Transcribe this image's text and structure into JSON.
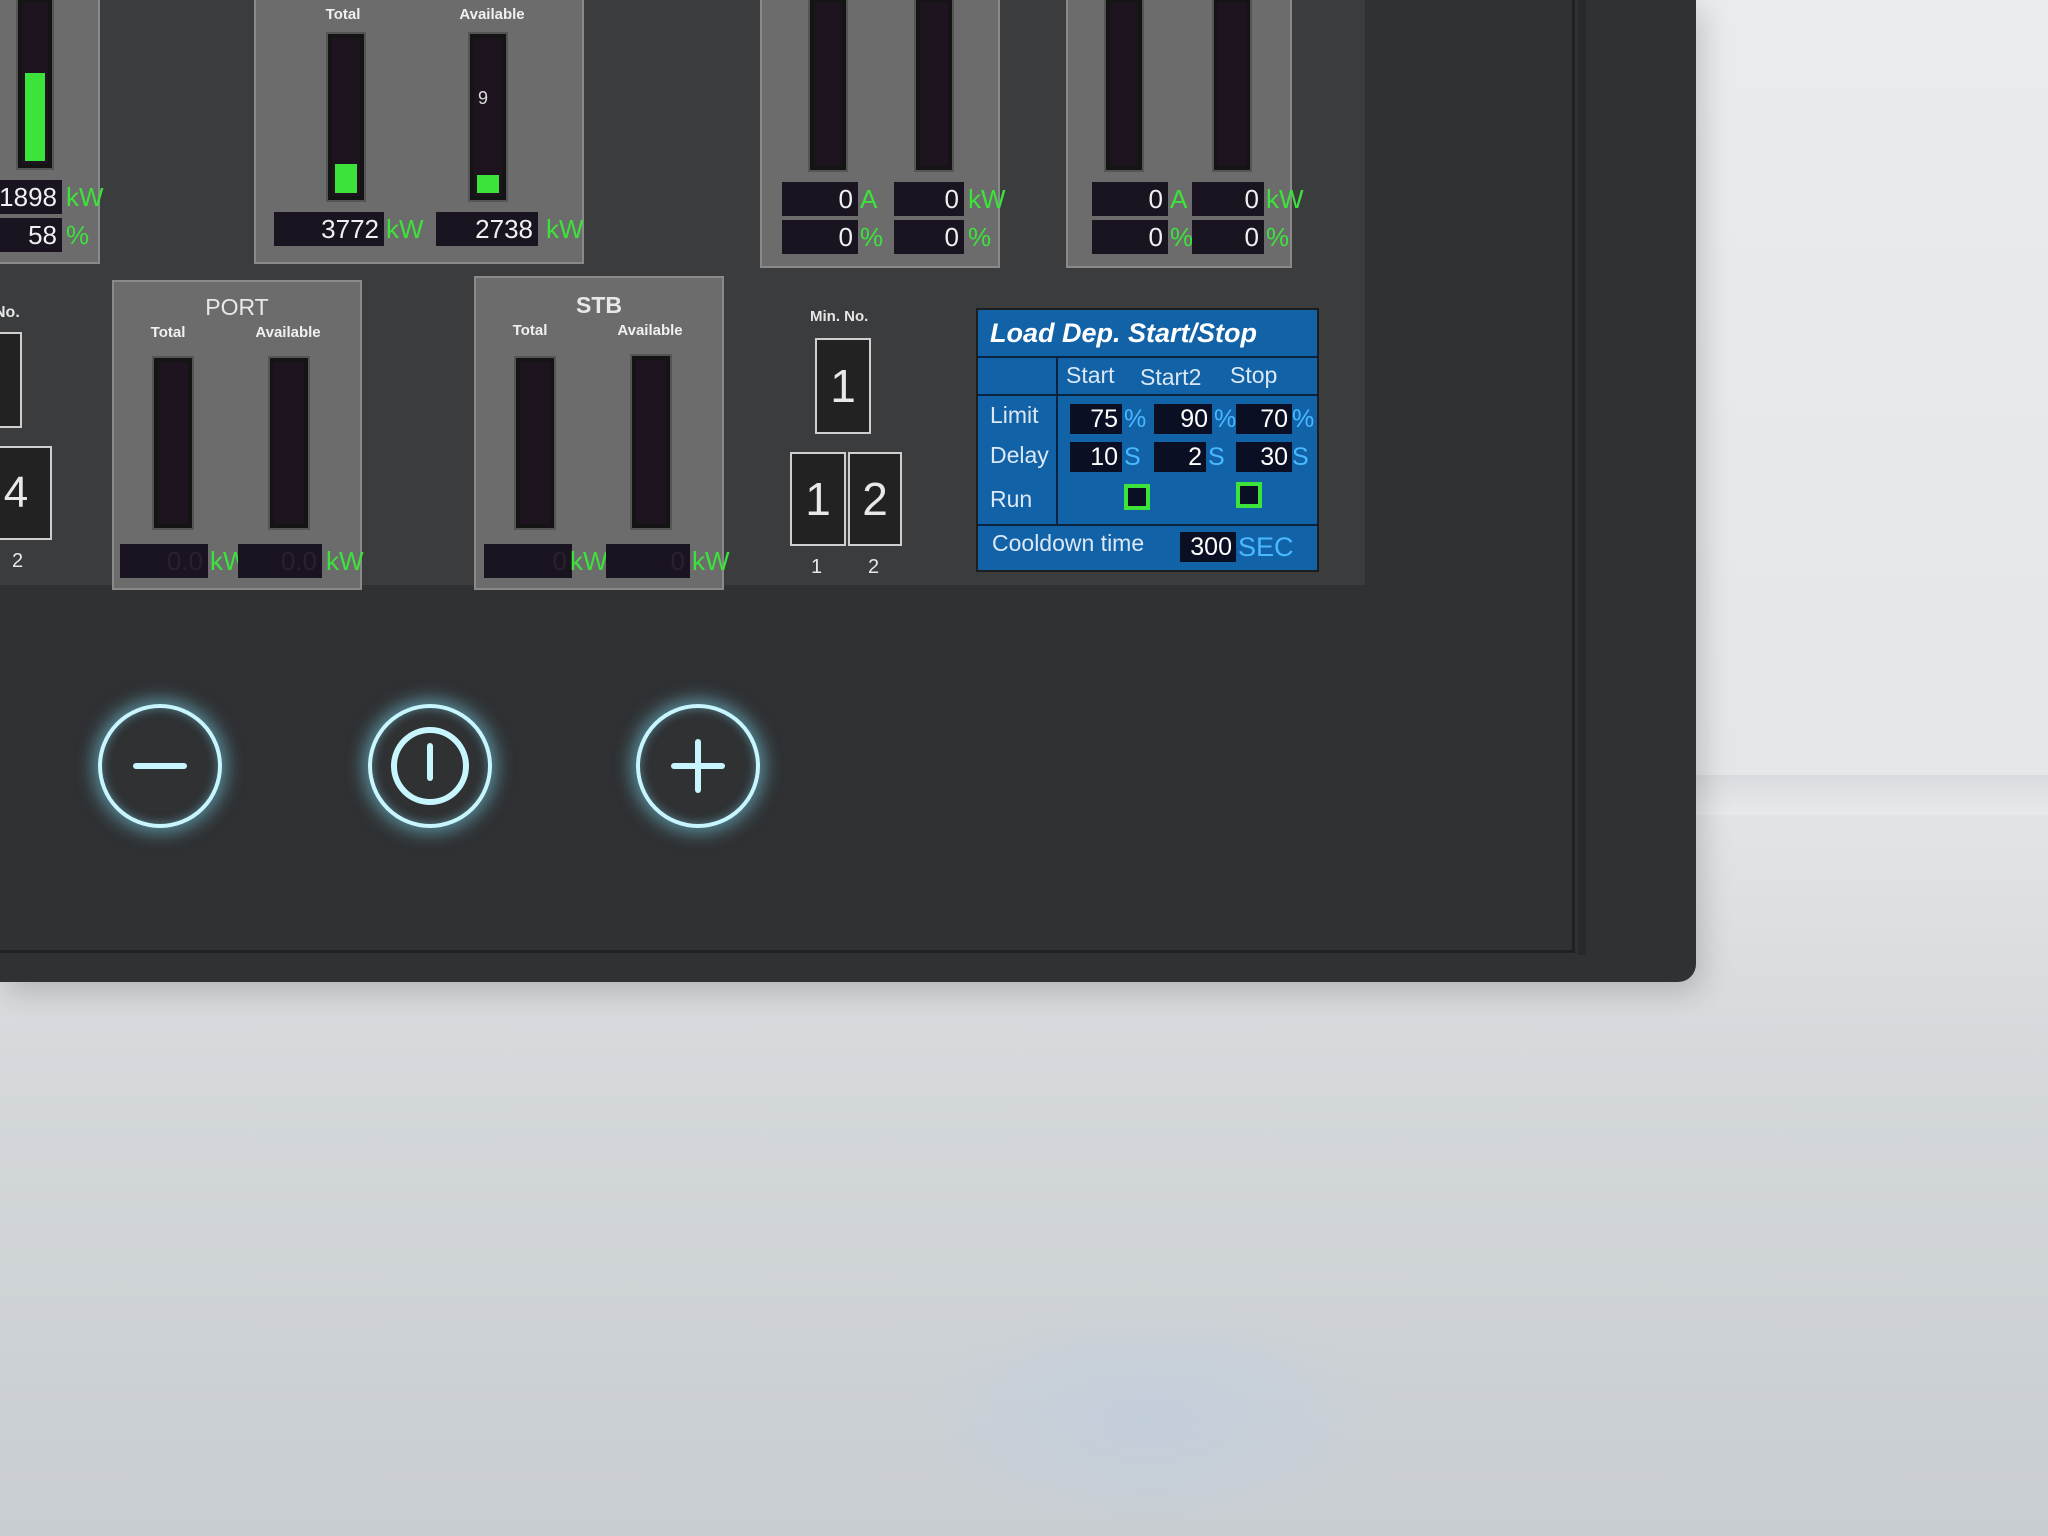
{
  "top_left_meter": {
    "value_kw": "1898",
    "unit_kw": "kW",
    "value_pct": "58",
    "unit_pct": "%",
    "fill_fraction": 0.58
  },
  "top_total_available": {
    "total_label": "Total",
    "available_label": "Available",
    "total_kw": "3772",
    "available_kw": "2738",
    "unit": "kW",
    "available_bar_text": "9",
    "total_fill_fraction": 0.22,
    "available_fill_fraction": 0.15
  },
  "top_gen_a": {
    "amps": "0",
    "amps_unit": "A",
    "kw": "0",
    "kw_unit": "kW",
    "pct1": "0",
    "pct2": "0",
    "pct_unit": "%"
  },
  "top_gen_b": {
    "amps": "0",
    "amps_unit": "A",
    "kw": "0",
    "kw_unit": "kW",
    "pct1": "0",
    "pct2": "0",
    "pct_unit": "%"
  },
  "left_min_no": {
    "label": "No.",
    "number": "4",
    "caption": "2"
  },
  "port": {
    "title": "PORT",
    "total_label": "Total",
    "available_label": "Available",
    "total_kw": "0.0",
    "available_kw": "0.0",
    "unit": "kW"
  },
  "stb": {
    "title": "STB",
    "total_label": "Total",
    "available_label": "Available",
    "total_kw": "0",
    "available_kw": "0",
    "unit": "kW"
  },
  "min_no": {
    "label": "Min. No.",
    "value": "1",
    "options": [
      "1",
      "2"
    ],
    "captions": [
      "1",
      "2"
    ]
  },
  "load_dep": {
    "title": "Load Dep. Start/Stop",
    "columns": [
      "Start",
      "Start2",
      "Stop"
    ],
    "limit_label": "Limit",
    "limits": [
      "75",
      "90",
      "70"
    ],
    "limit_unit": "%",
    "delay_label": "Delay",
    "delays": [
      "10",
      "2",
      "30"
    ],
    "delay_unit": "S",
    "run_label": "Run",
    "cooldown_label": "Cooldown time",
    "cooldown_value": "300",
    "cooldown_unit": "SEC"
  },
  "hardware_buttons": {
    "minus": "minus-icon",
    "power": "power-icon",
    "plus": "plus-icon"
  },
  "colors": {
    "accent_green": "#3be33b",
    "load_panel_blue": "#1262a8",
    "unit_blue": "#49b9ff",
    "button_glow": "#c8f6ff"
  }
}
